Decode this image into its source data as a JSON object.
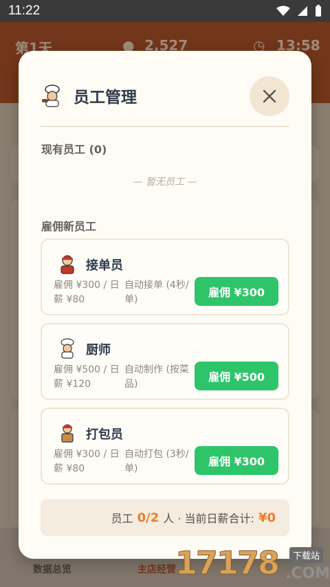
{
  "status_bar": {
    "time": "11:22"
  },
  "background": {
    "day": "第1天",
    "money": "2,527",
    "clock": "13:58",
    "nav": [
      "数据总览",
      "主店经营"
    ]
  },
  "modal": {
    "title": "员工管理",
    "current_staff_label": "现有员工 (0)",
    "empty_note": "— 暂无员工 —",
    "hire_section_label": "雇佣新员工",
    "staff": [
      {
        "name": "接单员",
        "cost": "雇佣 ¥300 / 日薪 ¥80",
        "desc": "自动接单 (4秒/单)",
        "button": "雇佣 ¥300",
        "icon": "waiter-icon"
      },
      {
        "name": "厨师",
        "cost": "雇佣 ¥500 / 日薪 ¥120",
        "desc": "自动制作 (按菜品)",
        "button": "雇佣 ¥500",
        "icon": "chef-icon"
      },
      {
        "name": "打包员",
        "cost": "雇佣 ¥300 / 日薪 ¥80",
        "desc": "自动打包 (3秒/单)",
        "button": "雇佣 ¥300",
        "icon": "packer-icon"
      }
    ],
    "summary": {
      "label_staff": "员工",
      "staff_count": "0/2",
      "label_rest": "人 · 当前日薪合计:",
      "total": "¥0"
    }
  },
  "watermark": {
    "main": "17178",
    "sub": ".COM",
    "tag": "下载站"
  },
  "colors": {
    "accent": "#2ec56a",
    "highlight": "#f07a2c",
    "header": "#a8471f"
  }
}
